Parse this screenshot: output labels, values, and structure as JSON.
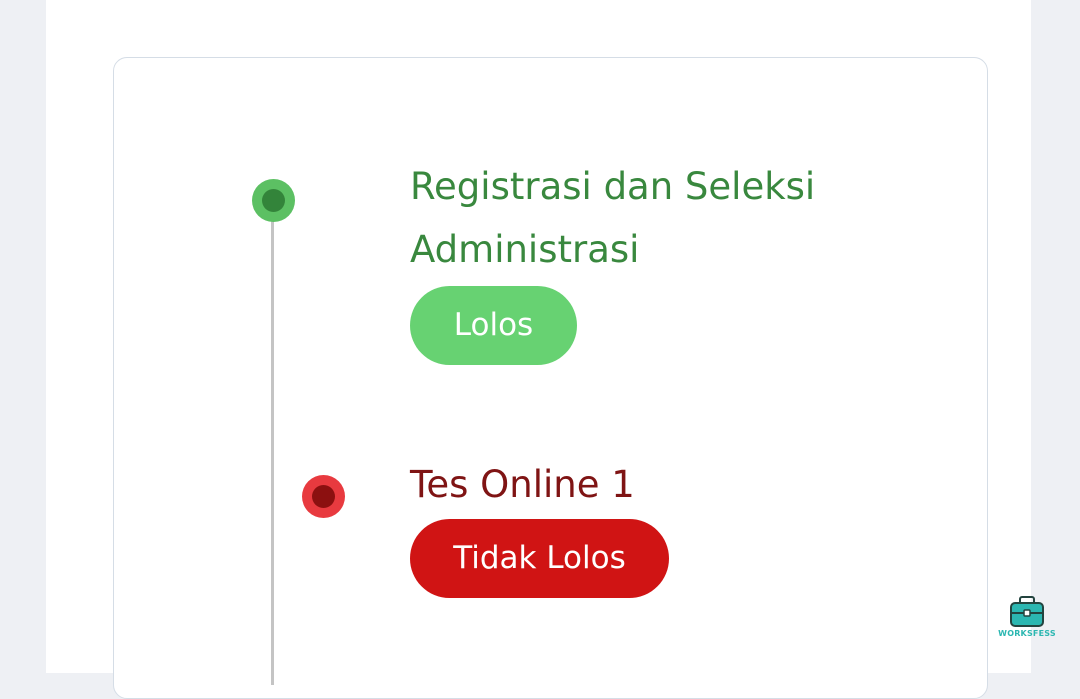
{
  "timeline": {
    "steps": [
      {
        "title": "Registrasi dan Seleksi Administrasi",
        "status": "Lolos",
        "status_color": "#67d272",
        "title_color": "#39883e"
      },
      {
        "title": "Tes Online 1",
        "status": "Tidak Lolos",
        "status_color": "#d01414",
        "title_color": "#7f1414"
      }
    ]
  },
  "watermark": {
    "text": "WORKSFESS",
    "icon": "briefcase-icon"
  }
}
